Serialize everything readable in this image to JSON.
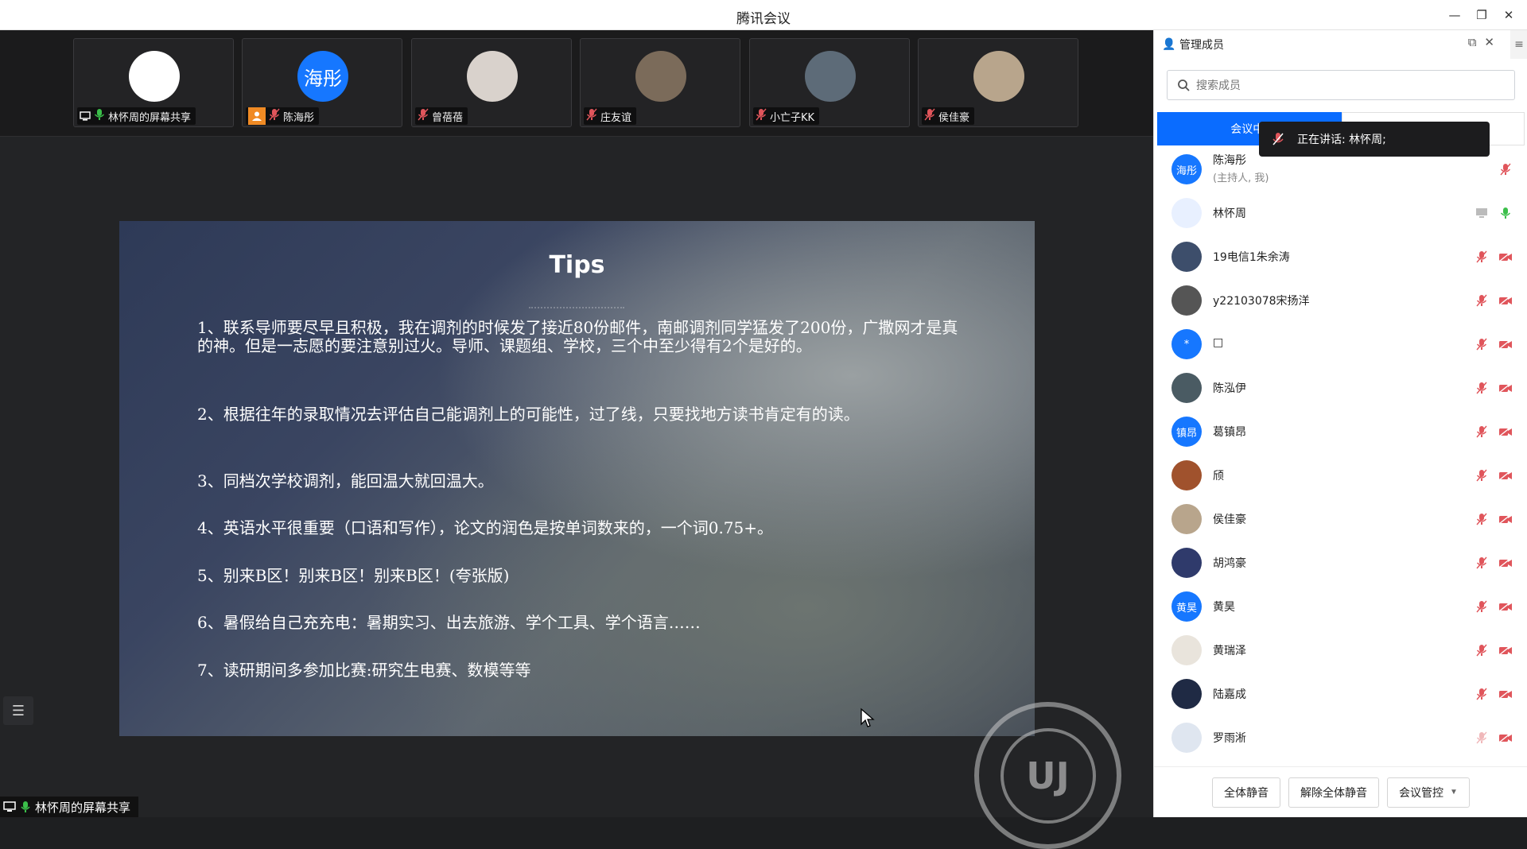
{
  "window": {
    "title": "腾讯会议"
  },
  "video_strip": [
    {
      "name": "林怀周的屏幕共享",
      "avatar_text": "",
      "avatar_color": "#ffffff",
      "icon": "screen-share-icon",
      "mic": "on"
    },
    {
      "name": "陈海彤",
      "avatar_text": "海彤",
      "avatar_color": "#1677ff",
      "icon": "person-icon",
      "mic": "off"
    },
    {
      "name": "曾蓓蓓",
      "avatar_text": "",
      "avatar_color": "#d9d2cc",
      "icon": "",
      "mic": "off"
    },
    {
      "name": "庄友谊",
      "avatar_text": "",
      "avatar_color": "#7b6b5a",
      "icon": "",
      "mic": "off"
    },
    {
      "name": "小亡子KK",
      "avatar_text": "",
      "avatar_color": "#5d6b78",
      "icon": "",
      "mic": "off"
    },
    {
      "name": "侯佳豪",
      "avatar_text": "",
      "avatar_color": "#b8a58c",
      "icon": "",
      "mic": "off"
    }
  ],
  "slide": {
    "title": "Tips",
    "tips": [
      "1、联系导师要尽早且积极，我在调剂的时候发了接近80份邮件，南邮调剂同学猛发了200份，广撒网才是真的神。但是一志愿的要注意别过火。导师、课题组、学校，三个中至少得有2个是好的。",
      "2、根据往年的录取情况去评估自己能调剂上的可能性，过了线，只要找地方读书肯定有的读。",
      "3、同档次学校调剂，能回温大就回温大。",
      "4、英语水平很重要（口语和写作），论文的润色是按单词数来的，一个词0.75+。",
      "5、别来B区！别来B区！别来B区！(夸张版)",
      "6、暑假给自己充充电：暑期实习、出去旅游、学个工具、学个语言……",
      "7、读研期间多参加比赛:研究生电赛、数模等等"
    ]
  },
  "share_tag": {
    "label": "林怀周的屏幕共享"
  },
  "panel": {
    "title": "管理成员",
    "search_placeholder": "搜索成员",
    "tab_active": "会议中(",
    "speaking_tooltip": "正在讲话: 林怀周;",
    "members": [
      {
        "name": "陈海彤",
        "sub": "(主持人, 我)",
        "avatar_text": "海彤",
        "avatar_color": "#1677ff",
        "mic": "off-red",
        "cam": "none",
        "screen": false
      },
      {
        "name": "林怀周",
        "sub": "",
        "avatar_text": "",
        "avatar_color": "#e8f0ff",
        "mic": "on-green",
        "cam": "none",
        "screen": true
      },
      {
        "name": "19电信1朱余涛",
        "sub": "",
        "avatar_text": "",
        "avatar_color": "#3d4e6b",
        "mic": "off-red",
        "cam": "off",
        "screen": false
      },
      {
        "name": "y22103078宋扬洋",
        "sub": "",
        "avatar_text": "",
        "avatar_color": "#555555",
        "mic": "off-red",
        "cam": "off",
        "screen": false
      },
      {
        "name": "□",
        "sub": "",
        "avatar_text": "*",
        "avatar_color": "#1677ff",
        "mic": "off-red",
        "cam": "off",
        "screen": false
      },
      {
        "name": "陈泓伊",
        "sub": "",
        "avatar_text": "",
        "avatar_color": "#4a5b63",
        "mic": "off-red",
        "cam": "off",
        "screen": false
      },
      {
        "name": "葛镇昂",
        "sub": "",
        "avatar_text": "镇昂",
        "avatar_color": "#1677ff",
        "mic": "off-red",
        "cam": "off",
        "screen": false
      },
      {
        "name": "颀",
        "sub": "",
        "avatar_text": "",
        "avatar_color": "#a0522d",
        "mic": "off-red",
        "cam": "off",
        "screen": false
      },
      {
        "name": "侯佳豪",
        "sub": "",
        "avatar_text": "",
        "avatar_color": "#b8a58c",
        "mic": "off-red",
        "cam": "off",
        "screen": false
      },
      {
        "name": "胡鸿豪",
        "sub": "",
        "avatar_text": "",
        "avatar_color": "#2f3a6b",
        "mic": "off-red",
        "cam": "off",
        "screen": false
      },
      {
        "name": "黄昊",
        "sub": "",
        "avatar_text": "黄昊",
        "avatar_color": "#1677ff",
        "mic": "off-red",
        "cam": "off",
        "screen": false
      },
      {
        "name": "黄瑞泽",
        "sub": "",
        "avatar_text": "",
        "avatar_color": "#e9e4dc",
        "mic": "off-red",
        "cam": "off",
        "screen": false
      },
      {
        "name": "陆嘉成",
        "sub": "",
        "avatar_text": "",
        "avatar_color": "#1f2a44",
        "mic": "off-red",
        "cam": "off",
        "screen": false
      },
      {
        "name": "罗雨淅",
        "sub": "",
        "avatar_text": "",
        "avatar_color": "#dfe6f0",
        "mic": "off-light",
        "cam": "off",
        "screen": false
      }
    ],
    "footer": {
      "mute_all": "全体静音",
      "unmute_all": "解除全体静音",
      "meeting_control": "会议管控"
    }
  },
  "colors": {
    "accent": "#0a6cff",
    "mic_off": "#e0555b",
    "mic_on": "#3bbf4a"
  }
}
